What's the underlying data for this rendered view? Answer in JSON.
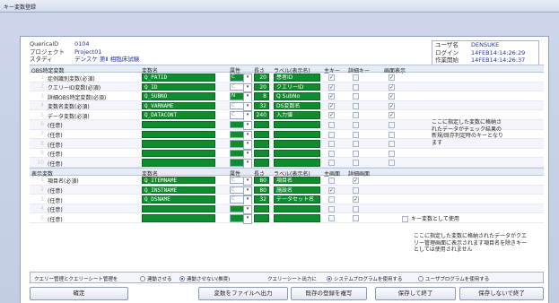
{
  "window": {
    "title": "キー変数登録"
  },
  "header_left": [
    {
      "key": "QuericaID",
      "value": "0104"
    },
    {
      "key": "プロジェクト",
      "value": "Project01"
    },
    {
      "key": "スタディ",
      "value": "デンスケ 第Ⅱ 相臨床試験"
    }
  ],
  "header_right": [
    {
      "key": "ユーザ名",
      "value": "DENSUKE"
    },
    {
      "key": "ログイン",
      "value": "14FEB14:14:26:29"
    },
    {
      "key": "作業開始",
      "value": "14FEB14:14:26:37"
    }
  ],
  "obs_section": {
    "headers": {
      "col1": "OBS特定変数",
      "col2": "変数名",
      "col3": "属性",
      "col4": "長さ",
      "col5": "ラベル(表示名)",
      "col6": "主キー",
      "col7": "詳細キー",
      "col8": "画面表示"
    },
    "rows": [
      {
        "num": "1",
        "label": "症例識別変数(必須)",
        "var": "Q_PATID",
        "attr": "C",
        "len": "20",
        "disp": "患者ID",
        "main": "✓",
        "detail": "",
        "screen": "✓",
        "attr_style": "g"
      },
      {
        "num": "2",
        "label": "クエリーID変数(必須)",
        "var": "Q_ID",
        "attr": "C",
        "len": "20",
        "disp": "クエリーID",
        "main": "✓",
        "detail": "",
        "screen": "✓",
        "attr_style": "c"
      },
      {
        "num": "3",
        "label": "詳細OBS特定変数(必須)",
        "var": "Q_SUBNO",
        "attr": "N",
        "len": "8",
        "disp": "Q SubNo",
        "main": "✓",
        "detail": "",
        "screen": "✓",
        "attr_style": "g"
      },
      {
        "num": "4",
        "label": "変数名変数(必須)",
        "var": "Q_VARNAME",
        "attr": "C",
        "len": "32",
        "disp": "DS変数名",
        "main": "✓",
        "detail": "",
        "screen": "✓",
        "attr_style": "c"
      },
      {
        "num": "5",
        "label": "データ変数(必須)",
        "var": "Q_DATACONT",
        "attr": "C",
        "len": "240",
        "disp": "入力値",
        "main": "✓",
        "detail": "",
        "screen": "✓",
        "attr_style": "c"
      },
      {
        "num": "6",
        "label": "(任意)",
        "var": "",
        "attr": "",
        "len": "",
        "disp": "",
        "main": "",
        "detail": "",
        "screen": "",
        "attr_style": "g"
      },
      {
        "num": "7",
        "label": "(任意)",
        "var": "",
        "attr": "",
        "len": "",
        "disp": "",
        "main": "",
        "detail": "",
        "screen": "",
        "attr_style": "g"
      },
      {
        "num": "8",
        "label": "(任意)",
        "var": "",
        "attr": "",
        "len": "",
        "disp": "",
        "main": "",
        "detail": "",
        "screen": "",
        "attr_style": "g"
      },
      {
        "num": "9",
        "label": "(任意)",
        "var": "",
        "attr": "",
        "len": "",
        "disp": "",
        "main": "",
        "detail": "",
        "screen": "",
        "attr_style": "g"
      },
      {
        "num": "10",
        "label": "(任意)",
        "var": "",
        "attr": "",
        "len": "",
        "disp": "",
        "main": "",
        "detail": "",
        "screen": "",
        "attr_style": "g"
      }
    ],
    "note": "ここに指定した変数に格納されたデータがチェック結果の新規/既存判定時のキーとなります"
  },
  "disp_section": {
    "headers": {
      "col1": "表示変数",
      "col2": "変数名",
      "col3": "属性",
      "col4": "長さ",
      "col5": "ラベル(表示名)",
      "col6": "主画面",
      "col7": "詳細画面"
    },
    "rows": [
      {
        "num": "1",
        "label": "項目名(必須)",
        "var": "Q_ITEMNAME",
        "attr": "C",
        "len": "80",
        "disp": "項目名",
        "main": "",
        "detail": "✓",
        "attr_style": "c"
      },
      {
        "num": "2",
        "label": "(任意)",
        "var": "Q_INSTNAME",
        "attr": "C",
        "len": "80",
        "disp": "施設名",
        "main": "✓",
        "detail": "",
        "attr_style": "c"
      },
      {
        "num": "3",
        "label": "(任意)",
        "var": "Q_DSNAME",
        "attr": "C",
        "len": "32",
        "disp": "データセット名",
        "main": "",
        "detail": "✓",
        "attr_style": "c"
      },
      {
        "num": "4",
        "label": "(任意)",
        "var": "",
        "attr": "",
        "len": "",
        "disp": "",
        "main": "",
        "detail": "",
        "attr_style": "g"
      },
      {
        "num": "5",
        "label": "(任意)",
        "var": "",
        "attr": "",
        "len": "",
        "disp": "",
        "main": "",
        "detail": "",
        "attr_style": "g"
      }
    ],
    "key_option": "キー変数として使用",
    "note": "ここに指定した変数に格納されたデータがクエリー管理画面に表示されます項目名を除きキーとしては使用されません"
  },
  "bottom_bar": {
    "label1": "クエリー管理とクエリーシート管理を",
    "opt1a": "連動させる",
    "opt1b": "連動させない(推奨)",
    "label2": "クエリーシート出力に",
    "opt2a": "システムプログラムを使用する",
    "opt2b": "ユーザプログラムを使用する"
  },
  "buttons": {
    "confirm": "確定",
    "export": "変数をファイルへ出力",
    "copy": "既存の登録を複写",
    "save_exit": "保存して終了",
    "exit_no_save": "保存しないで終了"
  },
  "colors": {
    "green_field": "#0e8c2e",
    "accent_text": "#2233aa"
  }
}
